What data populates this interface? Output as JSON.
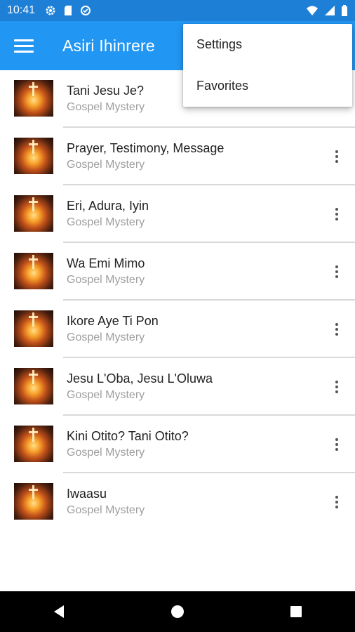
{
  "status_bar": {
    "time": "10:41",
    "left_icons": [
      "gear-icon",
      "sd-card-icon",
      "data-saver-icon"
    ],
    "right_icons": [
      "wifi-icon",
      "cell-signal-icon",
      "battery-icon"
    ]
  },
  "app_bar": {
    "title": "Asiri Ihinrere",
    "menu_icon": "hamburger-icon",
    "color": "#2196f3"
  },
  "overflow_menu": {
    "items": [
      {
        "label": "Settings"
      },
      {
        "label": "Favorites"
      }
    ]
  },
  "list": {
    "items": [
      {
        "title": "Tani Jesu Je?",
        "subtitle": "Gospel Mystery"
      },
      {
        "title": "Prayer, Testimony, Message",
        "subtitle": "Gospel Mystery"
      },
      {
        "title": "Eri, Adura, Iyin",
        "subtitle": "Gospel Mystery"
      },
      {
        "title": "Wa Emi Mimo",
        "subtitle": "Gospel Mystery"
      },
      {
        "title": "Ikore Aye Ti Pon",
        "subtitle": "Gospel Mystery"
      },
      {
        "title": "Jesu L'Oba, Jesu L'Oluwa",
        "subtitle": "Gospel Mystery"
      },
      {
        "title": "Kini Otito? Tani Otito?",
        "subtitle": "Gospel Mystery"
      },
      {
        "title": "Iwaasu",
        "subtitle": "Gospel Mystery"
      }
    ]
  },
  "nav_bar": {
    "buttons": [
      "back-icon",
      "home-icon",
      "recents-icon"
    ]
  }
}
